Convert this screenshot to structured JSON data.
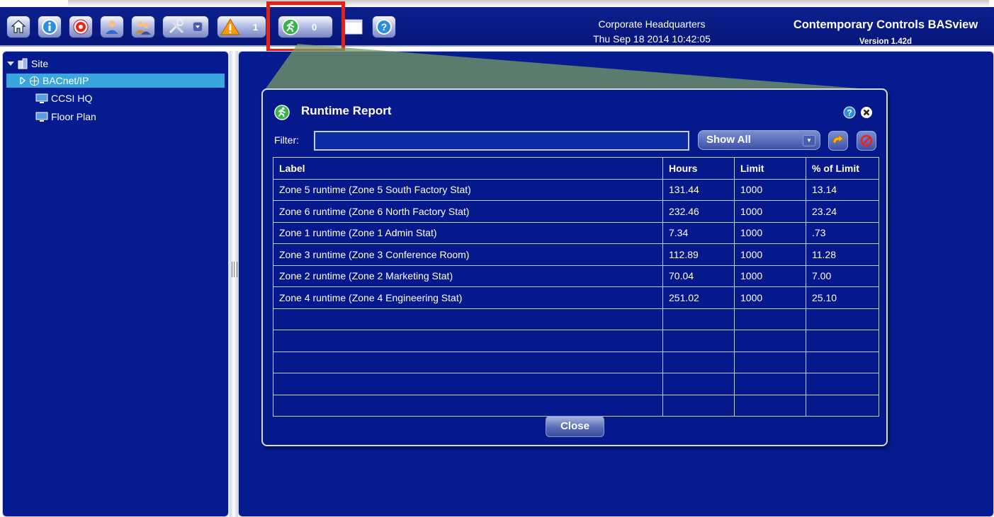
{
  "toolbar": {
    "buttons": [
      {
        "name": "home-button",
        "icon": "home-icon"
      },
      {
        "name": "info-button",
        "icon": "info-icon"
      },
      {
        "name": "alarm-button",
        "icon": "alarm-icon"
      },
      {
        "name": "user-button",
        "icon": "user-icon"
      },
      {
        "name": "users-button",
        "icon": "users-icon"
      },
      {
        "name": "tools-button",
        "icon": "tools-icon"
      },
      {
        "name": "alarms-button",
        "icon": "warning-icon"
      },
      {
        "name": "runtime-button",
        "icon": "runner-icon"
      },
      {
        "name": "window-button",
        "icon": "window-icon"
      },
      {
        "name": "help-button",
        "icon": "help-icon"
      }
    ],
    "alarm_count": "1",
    "runtime_count": "0"
  },
  "header": {
    "site_name": "Corporate Headquarters",
    "datetime": "Thu Sep 18 2014 10:42:05",
    "brand": "Contemporary Controls BASview",
    "version": "Version 1.42d"
  },
  "tree": {
    "root": "Site",
    "items": [
      "BACnet/IP",
      "CCSI HQ",
      "Floor Plan"
    ]
  },
  "dialog": {
    "title": "Runtime Report",
    "filter_label": "Filter:",
    "filter_value": "",
    "select_value": "Show All",
    "columns": [
      "Label",
      "Hours",
      "Limit",
      "% of Limit"
    ],
    "rows": [
      [
        "Zone 5 runtime (Zone 5 South Factory Stat)",
        "131.44",
        "1000",
        "13.14"
      ],
      [
        "Zone 6 runtime (Zone 6 North Factory Stat)",
        "232.46",
        "1000",
        "23.24"
      ],
      [
        "Zone 1 runtime (Zone 1 Admin Stat)",
        "7.34",
        "1000",
        ".73"
      ],
      [
        "Zone 3 runtime (Zone 3 Conference Room)",
        "112.89",
        "1000",
        "11.28"
      ],
      [
        "Zone 2 runtime (Zone 2 Marketing Stat)",
        "70.04",
        "1000",
        "7.00"
      ],
      [
        "Zone 4 runtime (Zone 4 Engineering Stat)",
        "251.02",
        "1000",
        "25.10"
      ],
      [
        "",
        "",
        "",
        ""
      ],
      [
        "",
        "",
        "",
        ""
      ],
      [
        "",
        "",
        "",
        ""
      ],
      [
        "",
        "",
        "",
        ""
      ],
      [
        "",
        "",
        "",
        ""
      ]
    ],
    "close_label": "Close"
  },
  "colors": {
    "background": "#061b90",
    "selection": "#3aa6e0",
    "highlight": "#e2231a"
  }
}
